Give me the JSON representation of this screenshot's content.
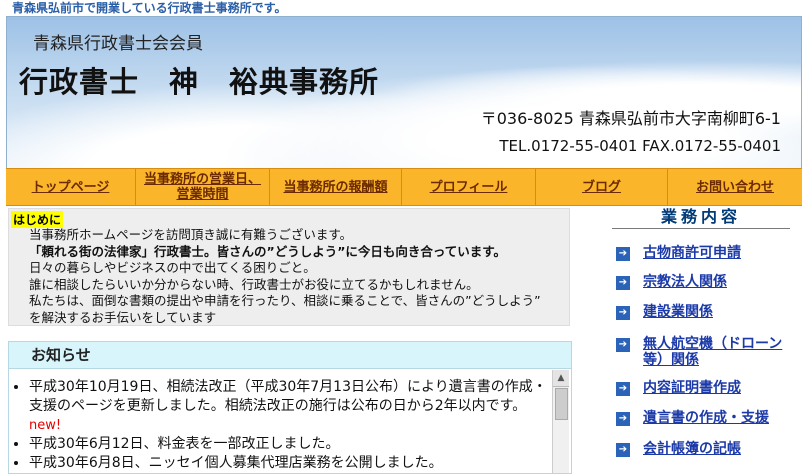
{
  "tagline": "青森県弘前市で開業している行政書士事務所です。",
  "header": {
    "association": "青森県行政書士会会員",
    "office_name": "行政書士　神　裕典事務所",
    "address": "〒036-8025 青森県弘前市大字南柳町6-1",
    "phone": "TEL.0172-55-0401 FAX.0172-55-0401"
  },
  "nav": [
    {
      "label": "トップページ"
    },
    {
      "label": "当事務所の営業日、営業時間"
    },
    {
      "label": "当事務所の報酬額"
    },
    {
      "label": "プロフィール"
    },
    {
      "label": "ブログ"
    },
    {
      "label": "お問い合わせ"
    }
  ],
  "intro": {
    "heading": "はじめに",
    "lines": [
      "当事務所ホームページを訪問頂き誠に有難うございます。",
      "「頼れる街の法律家」行政書士。皆さんの”どうしよう”に今日も向き合っています。",
      "日々の暮らしやビジネスの中で出てくる困りごと。",
      "誰に相談したらいいか分からない時、行政書士がお役に立てるかもしれません。",
      "私たちは、面倒な書類の提出や申請を行ったり、相談に乗ることで、皆さんの”どうしよう”",
      "を解決するお手伝いをしています"
    ]
  },
  "news": {
    "title": "お知らせ",
    "items": [
      {
        "text": "平成30年10月19日、相続法改正（平成30年7月13日公布）により遺言書の作成・支援のページを更新しました。相続法改正の施行は公布の日から2年以内です。",
        "badge": "new!"
      },
      {
        "text": "平成30年6月12日、料金表を一部改正しました。",
        "badge": ""
      },
      {
        "text": "平成30年6月8日、ニッセイ個人募集代理店業務を公開しました。",
        "badge": ""
      }
    ]
  },
  "services": {
    "title": "業務内容",
    "items": [
      {
        "label": "古物商許可申請"
      },
      {
        "label": "宗教法人関係"
      },
      {
        "label": "建設業関係"
      },
      {
        "label": "無人航空機（ドローン等）関係"
      },
      {
        "label": "内容証明書作成"
      },
      {
        "label": "遺言書の作成・支援"
      },
      {
        "label": "会計帳簿の記帳"
      }
    ]
  }
}
